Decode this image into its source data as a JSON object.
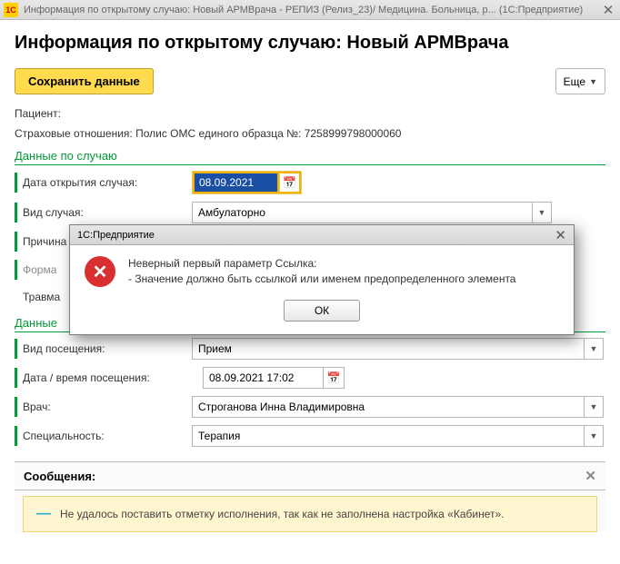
{
  "titlebar": {
    "title": "Информация по открытому случаю: Новый АРМВрача - РЕПИЗ (Релиз_23)/  Медицина. Больница, р...  (1С:Предприятие)"
  },
  "page": {
    "heading": "Информация по открытому случаю: Новый АРМВрача",
    "save_button": "Сохранить данные",
    "more_button": "Еще"
  },
  "static": {
    "patient_label": "Пациент:",
    "insurance_label": "Страховые отношения:",
    "insurance_value": "Полис ОМС единого образца №: 7258999798000060"
  },
  "sections": {
    "case": "Данные по случаю",
    "visit_prefix": "Данные"
  },
  "case": {
    "open_date_label": "Дата открытия случая:",
    "open_date_value": "08.09.2021",
    "type_label": "Вид случая:",
    "type_value": "Амбулаторно",
    "reason_label": "Причина",
    "form_label": "Форма",
    "trauma_label": "Травма"
  },
  "visit": {
    "type_label": "Вид посещения:",
    "type_value": "Прием",
    "datetime_label": "Дата / время посещения:",
    "datetime_value": "08.09.2021 17:02",
    "doctor_label": "Врач:",
    "doctor_value": "Строганова Инна Владимировна",
    "spec_label": "Специальность:",
    "spec_value": "Терапия"
  },
  "messages": {
    "header": "Сообщения:",
    "line1": "Не удалось поставить отметку исполнения, так как не заполнена настройка «Кабинет»."
  },
  "modal": {
    "title": "1С:Предприятие",
    "line1": "Неверный первый параметр Ссылка:",
    "line2": "- Значение должно быть ссылкой или именем предопределенного элемента",
    "ok": "ОК"
  }
}
